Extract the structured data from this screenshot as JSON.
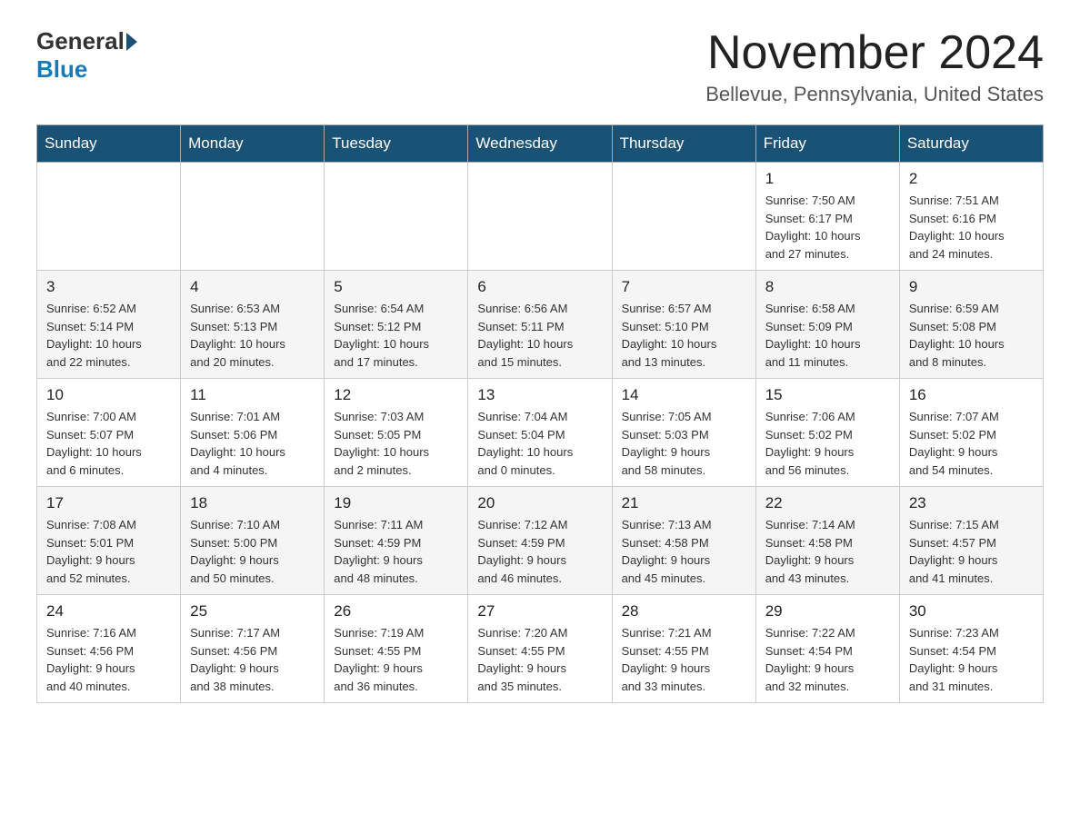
{
  "header": {
    "logo_general": "General",
    "logo_blue": "Blue",
    "month_title": "November 2024",
    "location": "Bellevue, Pennsylvania, United States"
  },
  "weekdays": [
    "Sunday",
    "Monday",
    "Tuesday",
    "Wednesday",
    "Thursday",
    "Friday",
    "Saturday"
  ],
  "weeks": [
    [
      {
        "day": "",
        "info": ""
      },
      {
        "day": "",
        "info": ""
      },
      {
        "day": "",
        "info": ""
      },
      {
        "day": "",
        "info": ""
      },
      {
        "day": "",
        "info": ""
      },
      {
        "day": "1",
        "info": "Sunrise: 7:50 AM\nSunset: 6:17 PM\nDaylight: 10 hours\nand 27 minutes."
      },
      {
        "day": "2",
        "info": "Sunrise: 7:51 AM\nSunset: 6:16 PM\nDaylight: 10 hours\nand 24 minutes."
      }
    ],
    [
      {
        "day": "3",
        "info": "Sunrise: 6:52 AM\nSunset: 5:14 PM\nDaylight: 10 hours\nand 22 minutes."
      },
      {
        "day": "4",
        "info": "Sunrise: 6:53 AM\nSunset: 5:13 PM\nDaylight: 10 hours\nand 20 minutes."
      },
      {
        "day": "5",
        "info": "Sunrise: 6:54 AM\nSunset: 5:12 PM\nDaylight: 10 hours\nand 17 minutes."
      },
      {
        "day": "6",
        "info": "Sunrise: 6:56 AM\nSunset: 5:11 PM\nDaylight: 10 hours\nand 15 minutes."
      },
      {
        "day": "7",
        "info": "Sunrise: 6:57 AM\nSunset: 5:10 PM\nDaylight: 10 hours\nand 13 minutes."
      },
      {
        "day": "8",
        "info": "Sunrise: 6:58 AM\nSunset: 5:09 PM\nDaylight: 10 hours\nand 11 minutes."
      },
      {
        "day": "9",
        "info": "Sunrise: 6:59 AM\nSunset: 5:08 PM\nDaylight: 10 hours\nand 8 minutes."
      }
    ],
    [
      {
        "day": "10",
        "info": "Sunrise: 7:00 AM\nSunset: 5:07 PM\nDaylight: 10 hours\nand 6 minutes."
      },
      {
        "day": "11",
        "info": "Sunrise: 7:01 AM\nSunset: 5:06 PM\nDaylight: 10 hours\nand 4 minutes."
      },
      {
        "day": "12",
        "info": "Sunrise: 7:03 AM\nSunset: 5:05 PM\nDaylight: 10 hours\nand 2 minutes."
      },
      {
        "day": "13",
        "info": "Sunrise: 7:04 AM\nSunset: 5:04 PM\nDaylight: 10 hours\nand 0 minutes."
      },
      {
        "day": "14",
        "info": "Sunrise: 7:05 AM\nSunset: 5:03 PM\nDaylight: 9 hours\nand 58 minutes."
      },
      {
        "day": "15",
        "info": "Sunrise: 7:06 AM\nSunset: 5:02 PM\nDaylight: 9 hours\nand 56 minutes."
      },
      {
        "day": "16",
        "info": "Sunrise: 7:07 AM\nSunset: 5:02 PM\nDaylight: 9 hours\nand 54 minutes."
      }
    ],
    [
      {
        "day": "17",
        "info": "Sunrise: 7:08 AM\nSunset: 5:01 PM\nDaylight: 9 hours\nand 52 minutes."
      },
      {
        "day": "18",
        "info": "Sunrise: 7:10 AM\nSunset: 5:00 PM\nDaylight: 9 hours\nand 50 minutes."
      },
      {
        "day": "19",
        "info": "Sunrise: 7:11 AM\nSunset: 4:59 PM\nDaylight: 9 hours\nand 48 minutes."
      },
      {
        "day": "20",
        "info": "Sunrise: 7:12 AM\nSunset: 4:59 PM\nDaylight: 9 hours\nand 46 minutes."
      },
      {
        "day": "21",
        "info": "Sunrise: 7:13 AM\nSunset: 4:58 PM\nDaylight: 9 hours\nand 45 minutes."
      },
      {
        "day": "22",
        "info": "Sunrise: 7:14 AM\nSunset: 4:58 PM\nDaylight: 9 hours\nand 43 minutes."
      },
      {
        "day": "23",
        "info": "Sunrise: 7:15 AM\nSunset: 4:57 PM\nDaylight: 9 hours\nand 41 minutes."
      }
    ],
    [
      {
        "day": "24",
        "info": "Sunrise: 7:16 AM\nSunset: 4:56 PM\nDaylight: 9 hours\nand 40 minutes."
      },
      {
        "day": "25",
        "info": "Sunrise: 7:17 AM\nSunset: 4:56 PM\nDaylight: 9 hours\nand 38 minutes."
      },
      {
        "day": "26",
        "info": "Sunrise: 7:19 AM\nSunset: 4:55 PM\nDaylight: 9 hours\nand 36 minutes."
      },
      {
        "day": "27",
        "info": "Sunrise: 7:20 AM\nSunset: 4:55 PM\nDaylight: 9 hours\nand 35 minutes."
      },
      {
        "day": "28",
        "info": "Sunrise: 7:21 AM\nSunset: 4:55 PM\nDaylight: 9 hours\nand 33 minutes."
      },
      {
        "day": "29",
        "info": "Sunrise: 7:22 AM\nSunset: 4:54 PM\nDaylight: 9 hours\nand 32 minutes."
      },
      {
        "day": "30",
        "info": "Sunrise: 7:23 AM\nSunset: 4:54 PM\nDaylight: 9 hours\nand 31 minutes."
      }
    ]
  ]
}
